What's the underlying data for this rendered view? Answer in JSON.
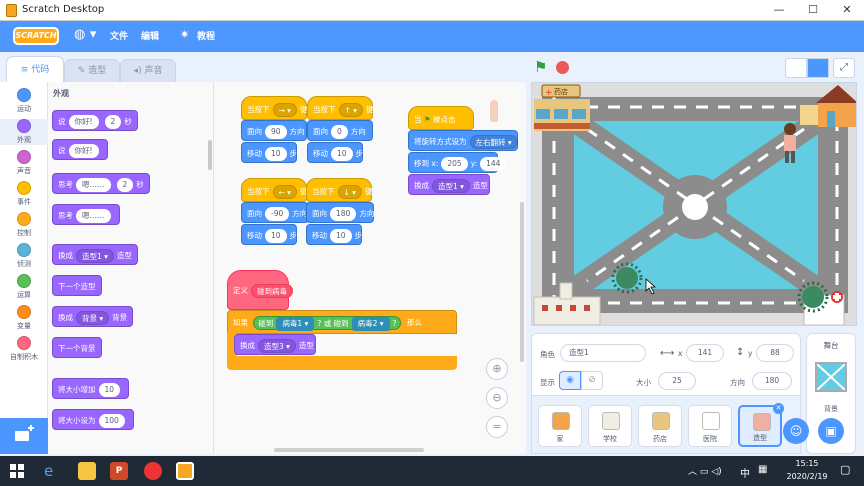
{
  "window": {
    "title": "Scratch Desktop"
  },
  "menu": {
    "file": "文件",
    "edit": "编辑",
    "tutorials": "教程",
    "logo": "SCRATCH"
  },
  "tabs": {
    "code": "代码",
    "costumes": "造型",
    "sounds": "声音"
  },
  "categories": [
    {
      "label": "运动",
      "color": "#4c97ff"
    },
    {
      "label": "外观",
      "color": "#9966ff"
    },
    {
      "label": "声音",
      "color": "#cf63cf"
    },
    {
      "label": "事件",
      "color": "#ffbf00"
    },
    {
      "label": "控制",
      "color": "#ffab19"
    },
    {
      "label": "侦测",
      "color": "#5cb1d6"
    },
    {
      "label": "运算",
      "color": "#59c059"
    },
    {
      "label": "变量",
      "color": "#ff8c1a"
    },
    {
      "label": "自制积木",
      "color": "#ff6680"
    }
  ],
  "palette": {
    "heading": "外观",
    "blocks": [
      {
        "pre": "说",
        "v1": "你好!",
        "mid": "",
        "v2": "2",
        "post": "秒"
      },
      {
        "pre": "说",
        "v1": "你好!",
        "mid": "",
        "v2": "",
        "post": ""
      },
      {
        "pre": "思考",
        "v1": "嗯……",
        "mid": "",
        "v2": "2",
        "post": "秒"
      },
      {
        "pre": "思考",
        "v1": "嗯……",
        "mid": "",
        "v2": "",
        "post": ""
      },
      {
        "pre": "换成",
        "d1": "造型1 ▾",
        "post": "造型"
      },
      {
        "pre": "下一个造型"
      },
      {
        "pre": "换成",
        "d1": "背景 ▾",
        "post": "背景"
      },
      {
        "pre": "下一个背景"
      },
      {
        "pre": "将大小增加",
        "v1": "10"
      },
      {
        "pre": "将大小设为",
        "v1": "100"
      }
    ]
  },
  "scripts": {
    "when_key": "当按下",
    "key_suffix": "键",
    "point": "面向",
    "direction": "方向",
    "move": "移动",
    "steps": "步",
    "keys": [
      "→ ▾",
      "↑ ▾",
      "← ▾",
      "↓ ▾"
    ],
    "angles": [
      "90",
      "0",
      "-90",
      "180"
    ],
    "step_value": "10",
    "flag_hat": "当",
    "flag_hat_suffix": "被点击",
    "rotation": "将旋转方式设为",
    "rotation_value": "左右翻转 ▾",
    "goto": "移到 x:",
    "goto_x": "205",
    "goto_y_label": "y:",
    "goto_y": "144",
    "switch": "换成",
    "switch_value": "造型1 ▾",
    "switch_suffix": "造型",
    "define": "定义",
    "define_name": "碰到病毒",
    "if": "如果",
    "touch": "碰到",
    "virus1": "病毒1 ▾",
    "virus2": "病毒2 ▾",
    "q": "?",
    "or": "或",
    "then": "那么",
    "switch_costume3": "造型3 ▾"
  },
  "stage": {
    "sign_pharmacy": "药店",
    "sign_pharmacy_icon": "+"
  },
  "sprite_info": {
    "sprite_label": "角色",
    "sprite_name": "造型1",
    "x_label": "x",
    "x": "141",
    "y_label": "y",
    "y": "88",
    "show_label": "显示",
    "size_label": "大小",
    "size": "25",
    "dir_label": "方向",
    "direction": "180"
  },
  "sprites": [
    {
      "name": "家"
    },
    {
      "name": "学校"
    },
    {
      "name": "药店"
    },
    {
      "name": "医院"
    },
    {
      "name": "造型"
    }
  ],
  "stage_panel": {
    "label": "舞台",
    "backdrop_label": "背景"
  },
  "taskbar": {
    "time": "15:15",
    "date": "2020/2/19",
    "ime": "中"
  },
  "colors": {
    "menubar": "#4d97ff",
    "accent": "#4c97ff"
  }
}
